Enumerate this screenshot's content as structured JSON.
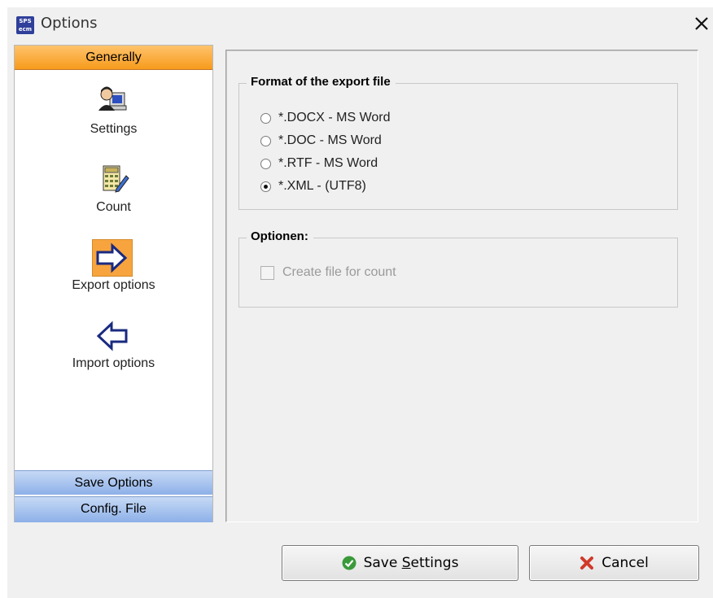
{
  "window": {
    "title": "Options",
    "app_icon_text_top": "SPS",
    "app_icon_text_bottom": "ecm"
  },
  "sidebar": {
    "groups": [
      {
        "label": "Generally",
        "state": "active"
      },
      {
        "label": "Save Options",
        "state": "collapsed"
      },
      {
        "label": "Config. File",
        "state": "collapsed"
      }
    ],
    "items": [
      {
        "label": "Settings",
        "icon": "user-computer-icon"
      },
      {
        "label": "Count",
        "icon": "calculator-icon"
      },
      {
        "label": "Export options",
        "icon": "arrow-right-icon",
        "selected": true
      },
      {
        "label": "Import options",
        "icon": "arrow-left-icon"
      }
    ]
  },
  "export_format": {
    "title": "Format of the export file",
    "options": [
      {
        "label": "*.DOCX - MS Word",
        "checked": false
      },
      {
        "label": "*.DOC - MS Word",
        "checked": false
      },
      {
        "label": "*.RTF - MS Word",
        "checked": false
      },
      {
        "label": "*.XML - (UTF8)",
        "checked": true
      }
    ]
  },
  "optionen": {
    "title": "Optionen:",
    "create_file_label": "Create file for count",
    "create_file_checked": false,
    "create_file_enabled": false
  },
  "buttons": {
    "save_pre": "Save ",
    "save_mnemonic": "S",
    "save_post": "ettings",
    "cancel": "Cancel"
  },
  "colors": {
    "active_group": "#f79b1c",
    "collapsed_group": "#8db0e8",
    "selected_item": "#f7a43e"
  }
}
